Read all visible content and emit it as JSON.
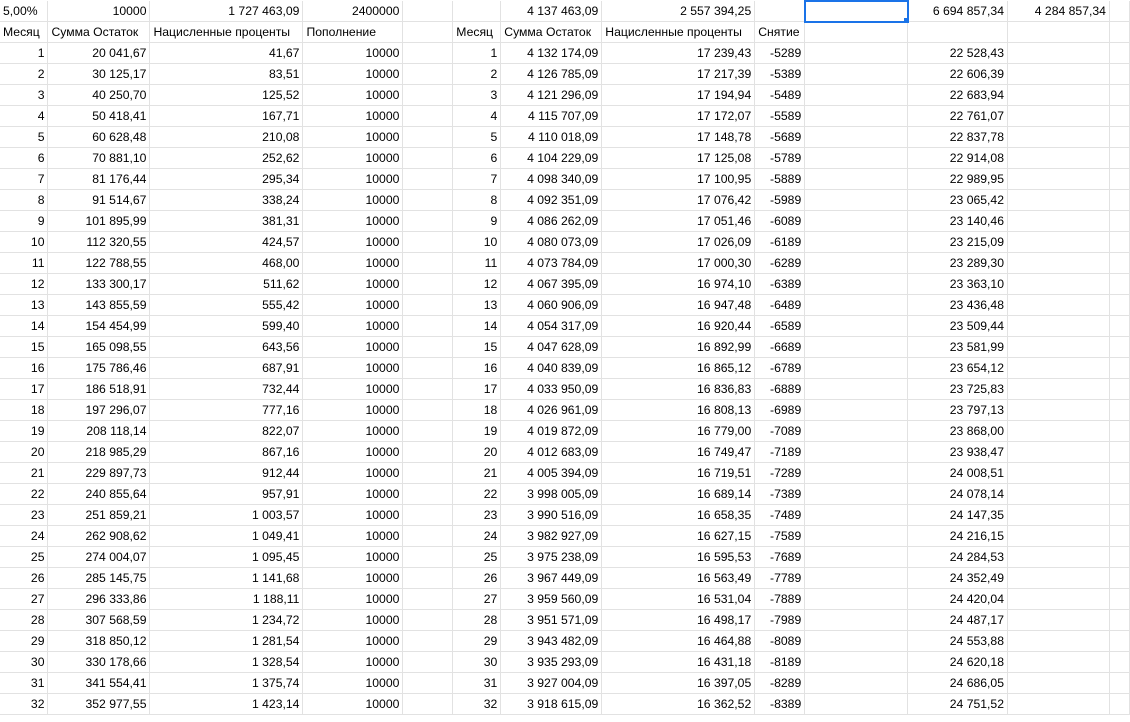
{
  "sheet": {
    "summary": {
      "rate": "5,00%",
      "deposit": "10000",
      "interest_total": "1 727 463,09",
      "deposit_total": "2400000",
      "balance2": "4 137 463,09",
      "interest2_total": "2 557 394,25",
      "selected_cell": "",
      "grand_total": "6 694 857,34",
      "grand_interest": "4 284 857,34"
    },
    "headers": {
      "month": "Месяц",
      "balance": "Сумма Остаток",
      "interest": "Нацисленные проценты",
      "replenish": "Пополнение",
      "month2": "Месяц",
      "balance2": "Сумма Остаток",
      "interest2": "Нацисленные проценты",
      "withdraw": "Снятие"
    },
    "rows": [
      {
        "month": "1",
        "balance": "20 041,67",
        "interest": "41,67",
        "replenish": "10000",
        "month2": "1",
        "balance2": "4 132 174,09",
        "interest2": "17 239,43",
        "withdraw": "-5289",
        "extra": "22 528,43"
      },
      {
        "month": "2",
        "balance": "30 125,17",
        "interest": "83,51",
        "replenish": "10000",
        "month2": "2",
        "balance2": "4 126 785,09",
        "interest2": "17 217,39",
        "withdraw": "-5389",
        "extra": "22 606,39"
      },
      {
        "month": "3",
        "balance": "40 250,70",
        "interest": "125,52",
        "replenish": "10000",
        "month2": "3",
        "balance2": "4 121 296,09",
        "interest2": "17 194,94",
        "withdraw": "-5489",
        "extra": "22 683,94"
      },
      {
        "month": "4",
        "balance": "50 418,41",
        "interest": "167,71",
        "replenish": "10000",
        "month2": "4",
        "balance2": "4 115 707,09",
        "interest2": "17 172,07",
        "withdraw": "-5589",
        "extra": "22 761,07"
      },
      {
        "month": "5",
        "balance": "60 628,48",
        "interest": "210,08",
        "replenish": "10000",
        "month2": "5",
        "balance2": "4 110 018,09",
        "interest2": "17 148,78",
        "withdraw": "-5689",
        "extra": "22 837,78"
      },
      {
        "month": "6",
        "balance": "70 881,10",
        "interest": "252,62",
        "replenish": "10000",
        "month2": "6",
        "balance2": "4 104 229,09",
        "interest2": "17 125,08",
        "withdraw": "-5789",
        "extra": "22 914,08"
      },
      {
        "month": "7",
        "balance": "81 176,44",
        "interest": "295,34",
        "replenish": "10000",
        "month2": "7",
        "balance2": "4 098 340,09",
        "interest2": "17 100,95",
        "withdraw": "-5889",
        "extra": "22 989,95"
      },
      {
        "month": "8",
        "balance": "91 514,67",
        "interest": "338,24",
        "replenish": "10000",
        "month2": "8",
        "balance2": "4 092 351,09",
        "interest2": "17 076,42",
        "withdraw": "-5989",
        "extra": "23 065,42"
      },
      {
        "month": "9",
        "balance": "101 895,99",
        "interest": "381,31",
        "replenish": "10000",
        "month2": "9",
        "balance2": "4 086 262,09",
        "interest2": "17 051,46",
        "withdraw": "-6089",
        "extra": "23 140,46"
      },
      {
        "month": "10",
        "balance": "112 320,55",
        "interest": "424,57",
        "replenish": "10000",
        "month2": "10",
        "balance2": "4 080 073,09",
        "interest2": "17 026,09",
        "withdraw": "-6189",
        "extra": "23 215,09"
      },
      {
        "month": "11",
        "balance": "122 788,55",
        "interest": "468,00",
        "replenish": "10000",
        "month2": "11",
        "balance2": "4 073 784,09",
        "interest2": "17 000,30",
        "withdraw": "-6289",
        "extra": "23 289,30"
      },
      {
        "month": "12",
        "balance": "133 300,17",
        "interest": "511,62",
        "replenish": "10000",
        "month2": "12",
        "balance2": "4 067 395,09",
        "interest2": "16 974,10",
        "withdraw": "-6389",
        "extra": "23 363,10"
      },
      {
        "month": "13",
        "balance": "143 855,59",
        "interest": "555,42",
        "replenish": "10000",
        "month2": "13",
        "balance2": "4 060 906,09",
        "interest2": "16 947,48",
        "withdraw": "-6489",
        "extra": "23 436,48"
      },
      {
        "month": "14",
        "balance": "154 454,99",
        "interest": "599,40",
        "replenish": "10000",
        "month2": "14",
        "balance2": "4 054 317,09",
        "interest2": "16 920,44",
        "withdraw": "-6589",
        "extra": "23 509,44"
      },
      {
        "month": "15",
        "balance": "165 098,55",
        "interest": "643,56",
        "replenish": "10000",
        "month2": "15",
        "balance2": "4 047 628,09",
        "interest2": "16 892,99",
        "withdraw": "-6689",
        "extra": "23 581,99"
      },
      {
        "month": "16",
        "balance": "175 786,46",
        "interest": "687,91",
        "replenish": "10000",
        "month2": "16",
        "balance2": "4 040 839,09",
        "interest2": "16 865,12",
        "withdraw": "-6789",
        "extra": "23 654,12"
      },
      {
        "month": "17",
        "balance": "186 518,91",
        "interest": "732,44",
        "replenish": "10000",
        "month2": "17",
        "balance2": "4 033 950,09",
        "interest2": "16 836,83",
        "withdraw": "-6889",
        "extra": "23 725,83"
      },
      {
        "month": "18",
        "balance": "197 296,07",
        "interest": "777,16",
        "replenish": "10000",
        "month2": "18",
        "balance2": "4 026 961,09",
        "interest2": "16 808,13",
        "withdraw": "-6989",
        "extra": "23 797,13"
      },
      {
        "month": "19",
        "balance": "208 118,14",
        "interest": "822,07",
        "replenish": "10000",
        "month2": "19",
        "balance2": "4 019 872,09",
        "interest2": "16 779,00",
        "withdraw": "-7089",
        "extra": "23 868,00"
      },
      {
        "month": "20",
        "balance": "218 985,29",
        "interest": "867,16",
        "replenish": "10000",
        "month2": "20",
        "balance2": "4 012 683,09",
        "interest2": "16 749,47",
        "withdraw": "-7189",
        "extra": "23 938,47"
      },
      {
        "month": "21",
        "balance": "229 897,73",
        "interest": "912,44",
        "replenish": "10000",
        "month2": "21",
        "balance2": "4 005 394,09",
        "interest2": "16 719,51",
        "withdraw": "-7289",
        "extra": "24 008,51"
      },
      {
        "month": "22",
        "balance": "240 855,64",
        "interest": "957,91",
        "replenish": "10000",
        "month2": "22",
        "balance2": "3 998 005,09",
        "interest2": "16 689,14",
        "withdraw": "-7389",
        "extra": "24 078,14"
      },
      {
        "month": "23",
        "balance": "251 859,21",
        "interest": "1 003,57",
        "replenish": "10000",
        "month2": "23",
        "balance2": "3 990 516,09",
        "interest2": "16 658,35",
        "withdraw": "-7489",
        "extra": "24 147,35"
      },
      {
        "month": "24",
        "balance": "262 908,62",
        "interest": "1 049,41",
        "replenish": "10000",
        "month2": "24",
        "balance2": "3 982 927,09",
        "interest2": "16 627,15",
        "withdraw": "-7589",
        "extra": "24 216,15"
      },
      {
        "month": "25",
        "balance": "274 004,07",
        "interest": "1 095,45",
        "replenish": "10000",
        "month2": "25",
        "balance2": "3 975 238,09",
        "interest2": "16 595,53",
        "withdraw": "-7689",
        "extra": "24 284,53"
      },
      {
        "month": "26",
        "balance": "285 145,75",
        "interest": "1 141,68",
        "replenish": "10000",
        "month2": "26",
        "balance2": "3 967 449,09",
        "interest2": "16 563,49",
        "withdraw": "-7789",
        "extra": "24 352,49"
      },
      {
        "month": "27",
        "balance": "296 333,86",
        "interest": "1 188,11",
        "replenish": "10000",
        "month2": "27",
        "balance2": "3 959 560,09",
        "interest2": "16 531,04",
        "withdraw": "-7889",
        "extra": "24 420,04"
      },
      {
        "month": "28",
        "balance": "307 568,59",
        "interest": "1 234,72",
        "replenish": "10000",
        "month2": "28",
        "balance2": "3 951 571,09",
        "interest2": "16 498,17",
        "withdraw": "-7989",
        "extra": "24 487,17"
      },
      {
        "month": "29",
        "balance": "318 850,12",
        "interest": "1 281,54",
        "replenish": "10000",
        "month2": "29",
        "balance2": "3 943 482,09",
        "interest2": "16 464,88",
        "withdraw": "-8089",
        "extra": "24 553,88"
      },
      {
        "month": "30",
        "balance": "330 178,66",
        "interest": "1 328,54",
        "replenish": "10000",
        "month2": "30",
        "balance2": "3 935 293,09",
        "interest2": "16 431,18",
        "withdraw": "-8189",
        "extra": "24 620,18"
      },
      {
        "month": "31",
        "balance": "341 554,41",
        "interest": "1 375,74",
        "replenish": "10000",
        "month2": "31",
        "balance2": "3 927 004,09",
        "interest2": "16 397,05",
        "withdraw": "-8289",
        "extra": "24 686,05"
      },
      {
        "month": "32",
        "balance": "352 977,55",
        "interest": "1 423,14",
        "replenish": "10000",
        "month2": "32",
        "balance2": "3 918 615,09",
        "interest2": "16 362,52",
        "withdraw": "-8389",
        "extra": "24 751,52"
      }
    ]
  }
}
